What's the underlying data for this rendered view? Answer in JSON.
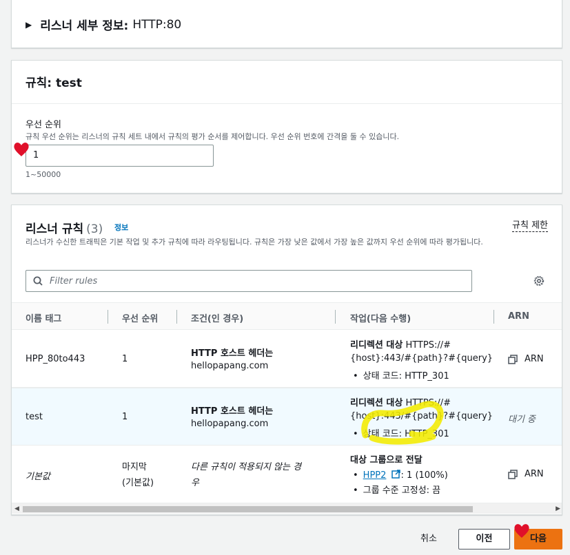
{
  "listener_details": {
    "caret": "▶",
    "label": "리스너 세부 정보:",
    "value": "HTTP:80"
  },
  "rule": {
    "title_prefix": "규칙:",
    "title_name": "test",
    "priority_label": "우선 순위",
    "priority_desc": "규칙 우선 순위는 리스너의 규칙 세트 내에서 규칙의 평가 순서를 제어합니다. 우선 순위 번호에 간격을 둘 수 있습니다.",
    "priority_value": "1",
    "priority_hint": "1~50000"
  },
  "listener_rules": {
    "title": "리스너 규칙",
    "count": "(3)",
    "info_link": "정보",
    "limit_link": "규칙 제한",
    "description": "리스너가 수신한 트래픽은 기본 작업 및 추가 규칙에 따라 라우팅됩니다. 규칙은 가장 낮은 값에서 가장 높은 값까지 우선 순위에 따라 평가됩니다.",
    "filter_placeholder": "Filter rules",
    "columns": [
      "이름 태그",
      "우선 순위",
      "조건(인 경우)",
      "작업(다음 수행)",
      "ARN"
    ],
    "rows": [
      {
        "name": "HPP_80to443",
        "priority": "1",
        "condition_title": "HTTP 호스트 헤더는",
        "condition_value": "hellopapang.com",
        "action_title": "리디렉션 대상",
        "action_url_1": "HTTPS://#",
        "action_url_2": "{host}:443/#{path}?#{query}",
        "action_bullet": "상태 코드: HTTP_301",
        "arn": "ARN"
      },
      {
        "name": "test",
        "priority": "1",
        "condition_title": "HTTP 호스트 헤더는",
        "condition_value": "hellopapang.com",
        "action_title": "리디렉션 대상",
        "action_url_1": "HTTPS://#",
        "action_url_2": "{host}:443/#{path}?#{query}",
        "action_bullet": "상태 코드: HTTP_301",
        "arn": "대기 중"
      },
      {
        "name": "기본값",
        "priority_1": "마지막",
        "priority_2": "(기본값)",
        "condition_1": "다른 규칙이 적용되지 않는 경",
        "condition_2": "우",
        "action_title": "대상 그룹으로 전달",
        "action_link": "HPP2",
        "action_link_suffix": ": 1 (100%)",
        "action_bullet": "그룹 수준 고정성: 끔",
        "arn": "ARN"
      }
    ]
  },
  "footer": {
    "cancel": "취소",
    "previous": "이전",
    "next": "다음"
  },
  "colors": {
    "primary": "#ec7211",
    "link": "#0073bb",
    "annotation_heart": "#e0102a",
    "annotation_highlight": "#f3ea00"
  }
}
